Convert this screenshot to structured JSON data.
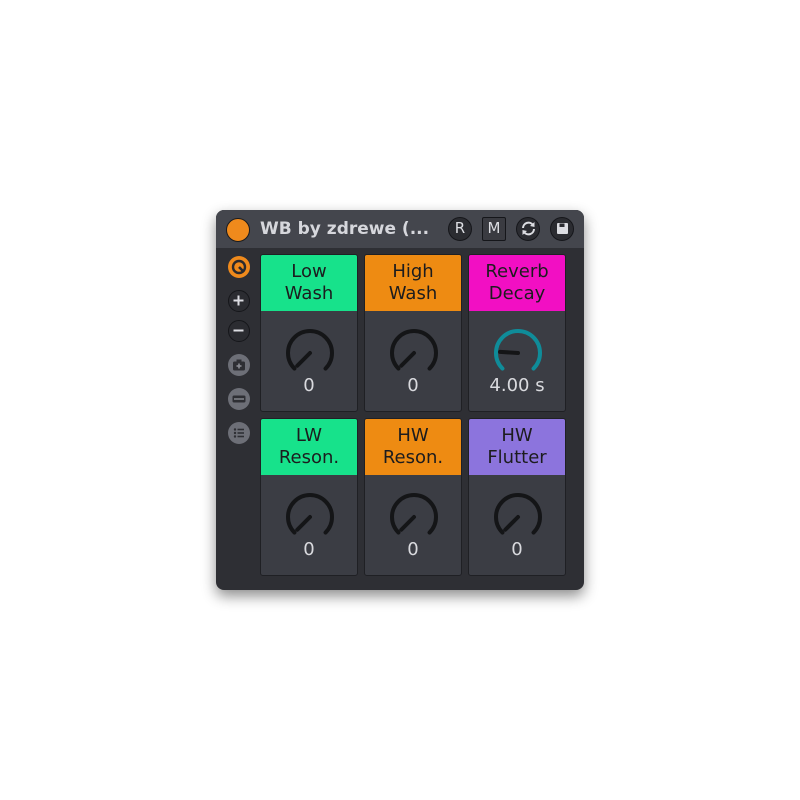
{
  "device": {
    "title": "WB by zdrewe (...",
    "buttons": {
      "r_label": "R",
      "m_label": "M"
    }
  },
  "sidebar": {
    "icons": [
      "hot-swap-icon",
      "add-icon",
      "remove-icon",
      "camera-icon",
      "macro-mapping-icon",
      "list-icon"
    ]
  },
  "macros": [
    {
      "label": "Low\nWash",
      "value": "0",
      "color": "#17e28b",
      "level": 0.0,
      "active": false
    },
    {
      "label": "High\nWash",
      "value": "0",
      "color": "#ee8b12",
      "level": 0.0,
      "active": false
    },
    {
      "label": "Reverb\nDecay",
      "value": "4.00 s",
      "color": "#f20fc3",
      "level": 0.18,
      "active": true
    },
    {
      "label": "LW\nReson.",
      "value": "0",
      "color": "#17e28b",
      "level": 0.0,
      "active": false
    },
    {
      "label": "HW\nReson.",
      "value": "0",
      "color": "#ee8b12",
      "level": 0.0,
      "active": false
    },
    {
      "label": "HW\nFlutter",
      "value": "0",
      "color": "#8c74dd",
      "level": 0.0,
      "active": false
    }
  ],
  "colors": {
    "accent": "#ef8a1c",
    "knob_ring": "#141517",
    "knob_ring_active": "#0f8c99"
  }
}
